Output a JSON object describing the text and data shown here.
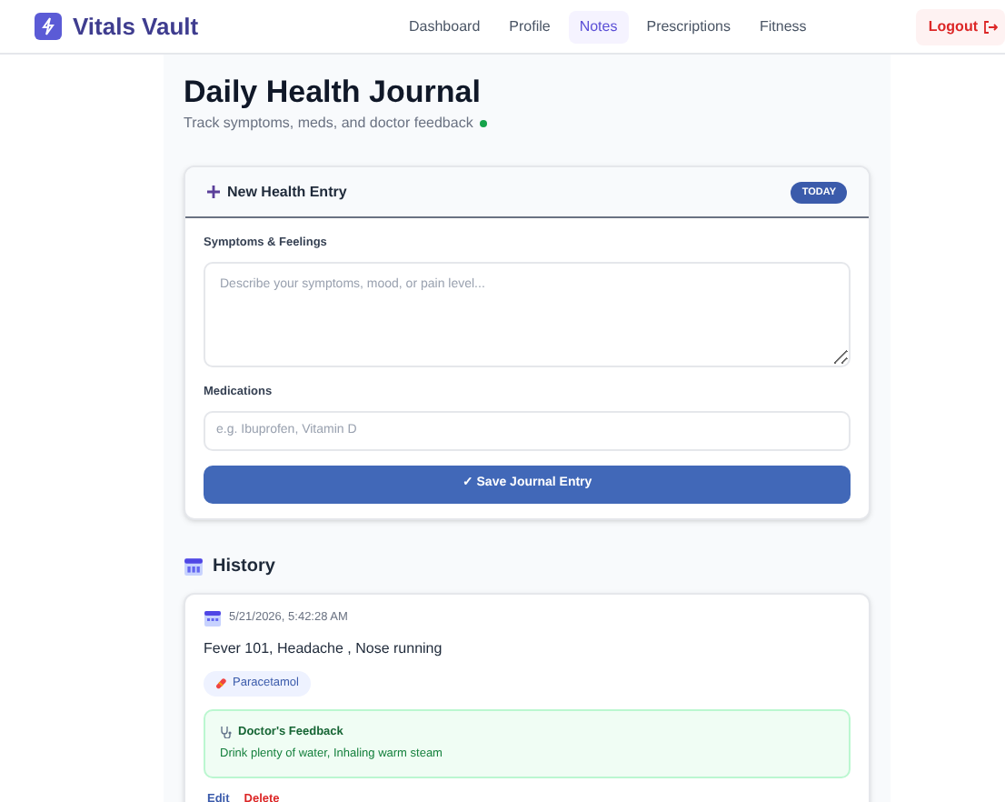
{
  "brand": "Vitals Vault",
  "nav": [
    {
      "label": "Dashboard",
      "selected": false
    },
    {
      "label": "Profile",
      "selected": false
    },
    {
      "label": "Notes",
      "selected": true
    },
    {
      "label": "Prescriptions",
      "selected": false
    },
    {
      "label": "Fitness",
      "selected": false
    }
  ],
  "logout": "Logout",
  "page": {
    "title": "Daily Health Journal",
    "subtitle": "Track symptoms, meds, and doctor feedback",
    "online": true
  },
  "form": {
    "title": "New Health Entry",
    "badge": "TODAY",
    "symptoms": {
      "label": "Symptoms & Feelings",
      "placeholder": "Describe your symptoms, mood, or pain level..."
    },
    "medications": {
      "label": "Medications",
      "placeholder": "e.g. Ibuprofen, Vitamin D"
    },
    "submit": "✓ Save Journal Entry"
  },
  "history": {
    "title": "History",
    "entries": [
      {
        "date": "5/21/2026, 5:42:28 AM",
        "text": "Fever 101, Headache , Nose running",
        "medications": [
          "Paracetamol"
        ],
        "feedback": {
          "title": "Doctor's Feedback",
          "text": "Drink plenty of water, Inhaling warm steam"
        },
        "actions": [
          {
            "label": "Edit",
            "kind": "edit"
          },
          {
            "label": "Delete",
            "kind": "delete"
          }
        ]
      }
    ]
  }
}
